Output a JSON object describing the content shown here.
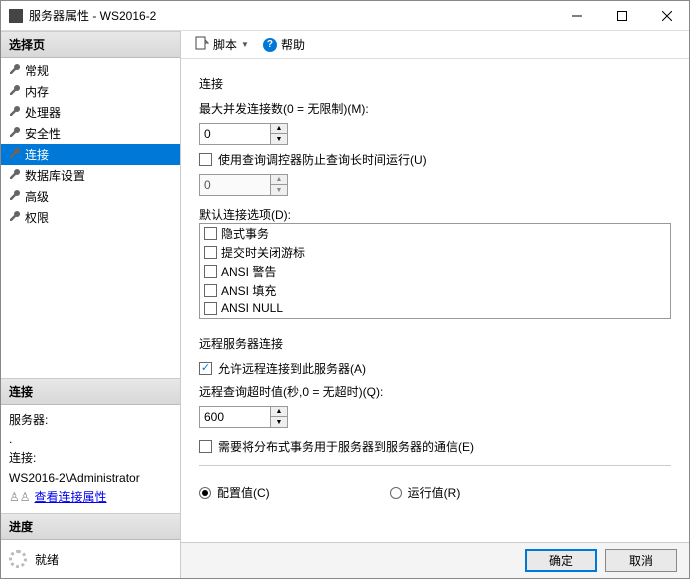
{
  "window": {
    "title": "服务器属性 - WS2016-2"
  },
  "sidebar": {
    "select_page": "选择页",
    "items": [
      "常规",
      "内存",
      "处理器",
      "安全性",
      "连接",
      "数据库设置",
      "高级",
      "权限"
    ],
    "selected_index": 4,
    "conn_header": "连接",
    "server_label": "服务器:",
    "server_value": ".",
    "conn_label": "连接:",
    "conn_value": "WS2016-2\\Administrator",
    "view_props": "查看连接属性",
    "progress_header": "进度",
    "progress_text": "就绪"
  },
  "toolbar": {
    "script": "脚本",
    "help": "帮助"
  },
  "conn": {
    "section": "连接",
    "max_label": "最大并发连接数(0 = 无限制)(M):",
    "max_value": "0",
    "governor_label": "使用查询调控器防止查询长时间运行(U)",
    "governor_value": "0",
    "default_opts_label": "默认连接选项(D):",
    "options": [
      "隐式事务",
      "提交时关闭游标",
      "ANSI 警告",
      "ANSI 填充",
      "ANSI NULL"
    ]
  },
  "remote": {
    "section": "远程服务器连接",
    "allow_label": "允许远程连接到此服务器(A)",
    "timeout_label": "远程查询超时值(秒,0 = 无超时)(Q):",
    "timeout_value": "600",
    "dist_label": "需要将分布式事务用于服务器到服务器的通信(E)"
  },
  "radios": {
    "config": "配置值(C)",
    "run": "运行值(R)"
  },
  "footer": {
    "ok": "确定",
    "cancel": "取消"
  }
}
